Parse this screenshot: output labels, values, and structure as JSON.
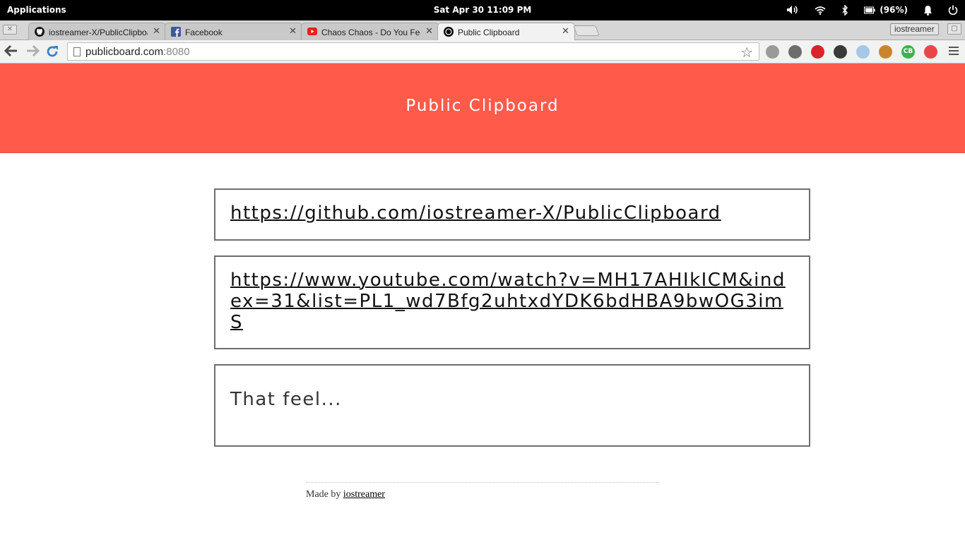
{
  "system_panel": {
    "applications_label": "Applications",
    "clock": "Sat Apr 30   11:09 PM",
    "battery": "(96%)"
  },
  "browser": {
    "tabs": [
      {
        "title": "iostreamer-X/PublicClipboard",
        "icon": "github-icon",
        "active": false
      },
      {
        "title": "Facebook",
        "icon": "facebook-icon",
        "active": false
      },
      {
        "title": "Chaos Chaos - Do You Feel It",
        "icon": "youtube-icon",
        "active": false
      },
      {
        "title": "Public Clipboard",
        "icon": "site-icon",
        "active": true
      }
    ],
    "profile_name": "iostreamer",
    "url_host": "publicboard.com",
    "url_port": ":8080",
    "extensions": [
      {
        "name": "globe-extension-icon",
        "color": "#9a9a9a",
        "glyph": ""
      },
      {
        "name": "camera-extension-icon",
        "color": "#6d6d6d",
        "glyph": ""
      },
      {
        "name": "adblock-extension-icon",
        "color": "#d8252b",
        "glyph": ""
      },
      {
        "name": "pocket-extension-icon",
        "color": "#3a3a3a",
        "glyph": ""
      },
      {
        "name": "weather-extension-icon",
        "color": "#a6c7e6",
        "glyph": ""
      },
      {
        "name": "owl-extension-icon",
        "color": "#c9852e",
        "glyph": ""
      },
      {
        "name": "cb-extension-icon",
        "color": "#3fb24f",
        "glyph": "CB"
      },
      {
        "name": "cast-extension-icon",
        "color": "#e8474a",
        "glyph": ""
      }
    ]
  },
  "page": {
    "title": "Public Clipboard",
    "clips": [
      {
        "text": "https://github.com/iostreamer-X/PublicClipboard",
        "is_link": true
      },
      {
        "text": "https://www.youtube.com/watch?v=MH17AHIkICM&index=31&list=PL1_wd7Bfg2uhtxdYDK6bdHBA9bwOG3imS",
        "is_link": true
      },
      {
        "text": "That feel...",
        "is_link": false
      }
    ],
    "footer_prefix": "Made by ",
    "footer_author": "iostreamer"
  },
  "colors": {
    "header_bg": "#ff5a4a"
  }
}
